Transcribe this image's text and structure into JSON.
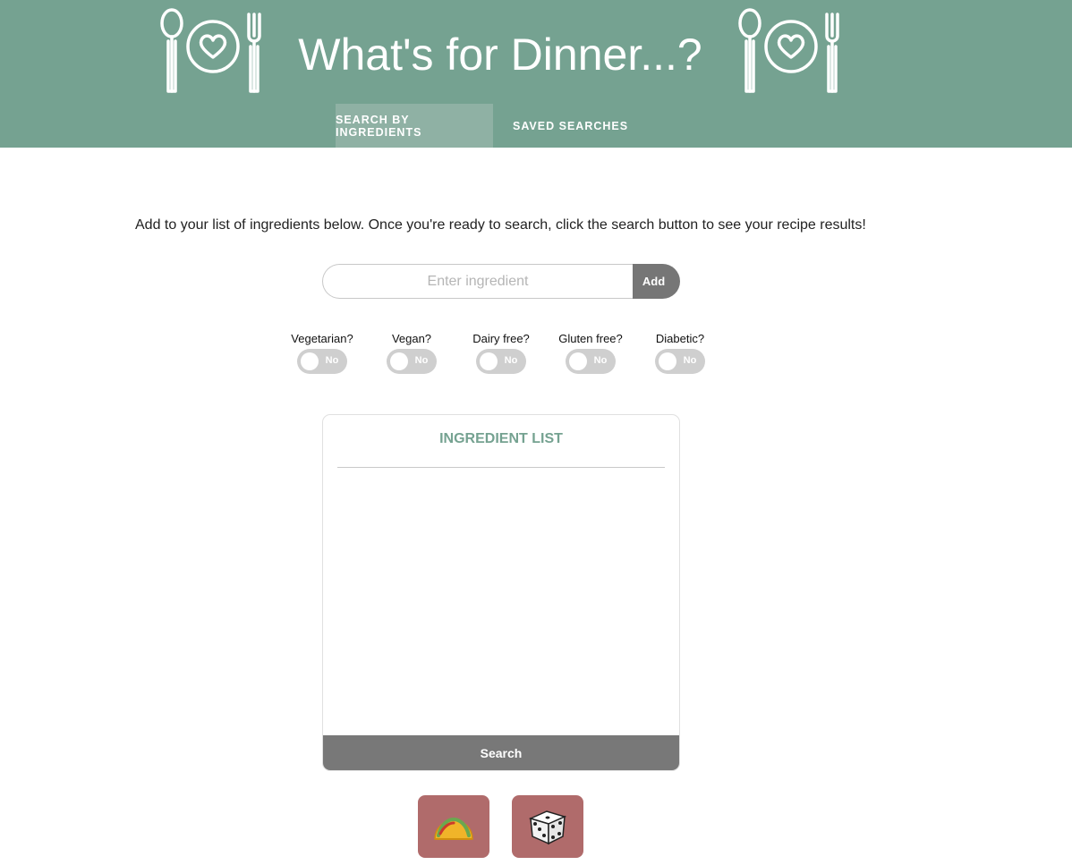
{
  "header": {
    "title": "What's for Dinner...?",
    "logo_icon": "plate-heart-utensils-icon",
    "background_color": "#75a291"
  },
  "tabs": [
    {
      "label": "SEARCH BY INGREDIENTS",
      "active": true
    },
    {
      "label": "SAVED SEARCHES",
      "active": false
    }
  ],
  "main": {
    "intro_text": "Add to your list of ingredients below. Once you're ready to search, click the search button to see your recipe results!",
    "ingredient_input": {
      "placeholder": "Enter ingredient",
      "value": ""
    },
    "add_label": "Add"
  },
  "filters": [
    {
      "label": "Vegetarian?",
      "state": "No"
    },
    {
      "label": "Vegan?",
      "state": "No"
    },
    {
      "label": "Dairy free?",
      "state": "No"
    },
    {
      "label": "Gluten free?",
      "state": "No"
    },
    {
      "label": "Diabetic?",
      "state": "No"
    }
  ],
  "ingredient_list": {
    "title": "INGREDIENT LIST",
    "items": [],
    "search_label": "Search"
  },
  "extra_buttons": [
    {
      "icon": "taco-icon"
    },
    {
      "icon": "dice-icon"
    }
  ],
  "colors": {
    "accent": "#75a291",
    "button_gray": "#767676",
    "emoji_button": "#b06b6b"
  }
}
